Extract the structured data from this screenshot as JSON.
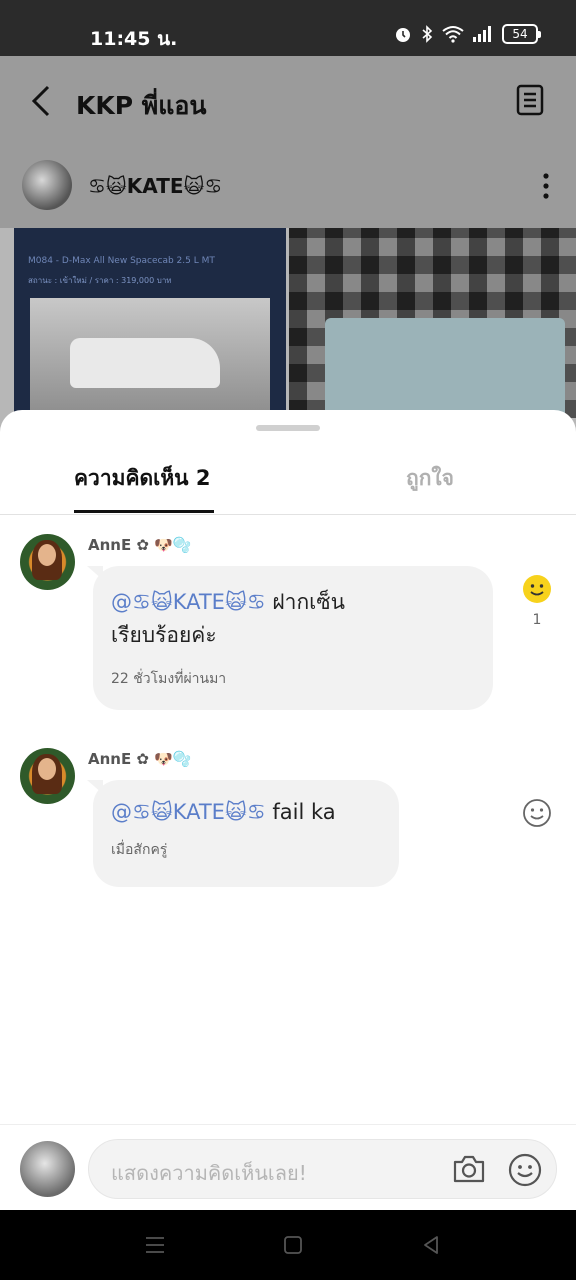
{
  "status_bar": {
    "time": "11:45 น.",
    "battery": "54"
  },
  "app_bar": {
    "title": "KKP พี่แอน"
  },
  "post": {
    "username": "♋🙀KATE🙀♋",
    "photo_left_line1": "M084 - D-Max All New Spacecab 2.5 L MT",
    "photo_left_line2": "สถานะ : เข้าใหม่ / ราคา : 319,000 บาท"
  },
  "tabs": {
    "comments": "ความคิดเห็น 2",
    "likes": "ถูกใจ"
  },
  "comments": [
    {
      "author": "AnnE ✿ 🐶🫧",
      "mention": "@♋🙀KATE🙀♋",
      "text_line1": " ฝากเซ็น",
      "text_line2": "เรียบร้อยค่ะ",
      "time": "22 ชั่วโมงที่ผ่านมา",
      "reaction_count": "1"
    },
    {
      "author": "AnnE ✿ 🐶🫧",
      "mention": "@♋🙀KATE🙀♋",
      "text_line1": " fail ka",
      "time": "เมื่อสักครู่"
    }
  ],
  "input": {
    "placeholder": "แสดงความคิดเห็นเลย!"
  },
  "colors": {
    "mention": "#5b7ec9",
    "reaction_yellow": "#f7d21c"
  },
  "icons": [
    "back-icon",
    "document-icon",
    "more-icon",
    "smiley-icon",
    "camera-icon",
    "menu-icon",
    "home-icon",
    "back-triangle-icon"
  ]
}
